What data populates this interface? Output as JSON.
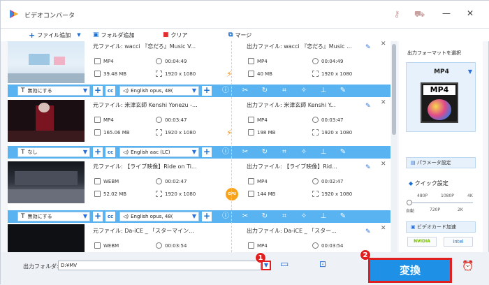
{
  "window": {
    "title": "ビデオコンバータ"
  },
  "toolbar": {
    "add_file": "ファイル追加",
    "add_folder": "フォルダ追加",
    "clear": "クリア",
    "merge": "マージ"
  },
  "items": [
    {
      "src_name": "元ファイル: wacci 『恋だろ』Music V...",
      "src_format": "MP4",
      "src_duration": "00:04:49",
      "src_size": "39.48 MB",
      "src_res": "1920 x 1080",
      "out_name": "出力ファイル: wacci 『恋だろ』Music ...",
      "out_format": "MP4",
      "out_duration": "00:04:49",
      "out_size": "40 MB",
      "out_res": "1920 x 1080",
      "subtitle": "無効にする",
      "audio": "English opus, 48(",
      "accel": "bolt"
    },
    {
      "src_name": "元ファイル: 米津玄師 Kenshi Yonezu -...",
      "src_format": "MP4",
      "src_duration": "00:03:47",
      "src_size": "165.06 MB",
      "src_res": "1920 x 1080",
      "out_name": "出力ファイル: 米津玄師 Kenshi Y...",
      "out_format": "MP4",
      "out_duration": "00:03:47",
      "out_size": "198 MB",
      "out_res": "1920 x 1080",
      "subtitle": "なし",
      "audio": "English aac (LC)",
      "accel": "bolt"
    },
    {
      "src_name": "元ファイル: 【ライブ映像】Ride on Ti...",
      "src_format": "WEBM",
      "src_duration": "00:02:47",
      "src_size": "52.02 MB",
      "src_res": "1920 x 1080",
      "out_name": "出力ファイル: 【ライブ映像】Rid...",
      "out_format": "MP4",
      "out_duration": "00:02:47",
      "out_size": "144 MB",
      "out_res": "1920 x 1080",
      "subtitle": "無効にする",
      "audio": "English opus, 48(",
      "accel": "GPU"
    },
    {
      "src_name": "元ファイル: Da-iCE _ 「スターマイン...",
      "src_format": "WEBM",
      "src_duration": "00:03:54",
      "out_name": "出力ファイル: Da-iCE _ 「スター...",
      "out_format": "MP4",
      "out_duration": "00:03:54"
    }
  ],
  "right_panel": {
    "format_select_label": "出力フォーマットを選択",
    "format": "MP4",
    "format_big": "MP4",
    "param_button": "パラメータ設定",
    "quick_settings": "クイック設定",
    "quality_top": [
      "480P",
      "1080P",
      "4K"
    ],
    "quality_bottom": [
      "自動",
      "720P",
      "2K"
    ],
    "gpu_accel": "ビデオカード加速",
    "nvidia": "NVIDIA",
    "intel": "intel"
  },
  "bottom": {
    "folder_label": "出力フォルダ:",
    "folder_path": "D:¥MV",
    "convert": "変換",
    "badge1": "1",
    "badge2": "2"
  },
  "colors": {
    "accent": "#1e90e6",
    "control_bar": "#58b3f0",
    "highlight": "#e02020"
  }
}
